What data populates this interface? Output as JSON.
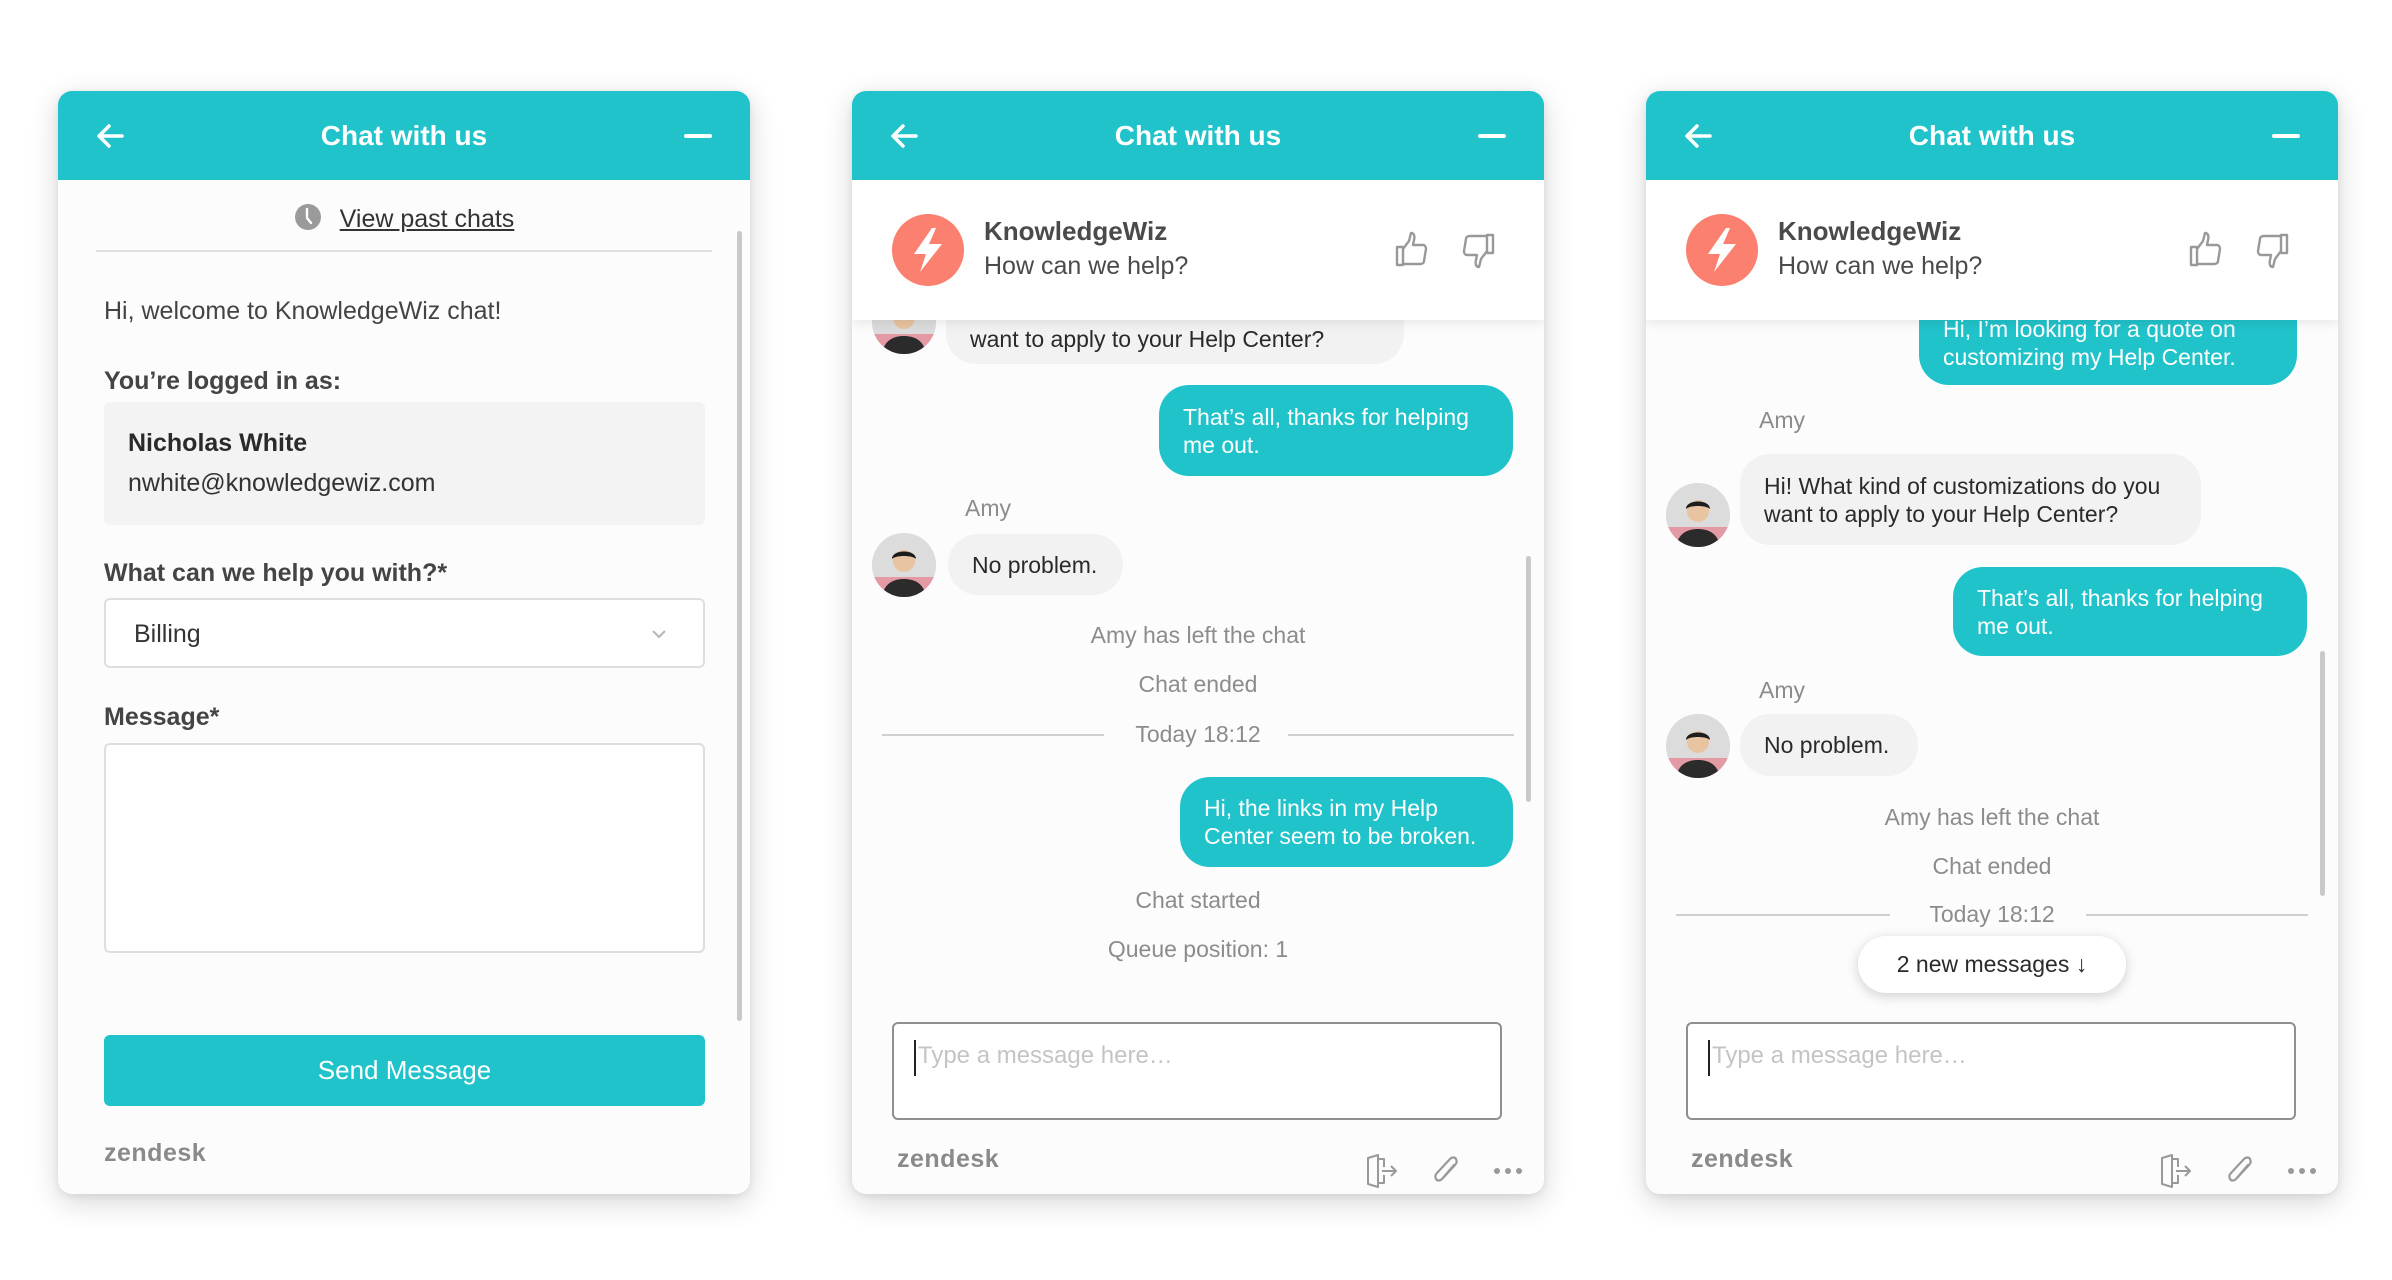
{
  "colors": {
    "accent": "#21c3cb",
    "brand_logo": "#fb806f"
  },
  "header": {
    "title": "Chat with us",
    "back_icon": "arrow-left-icon",
    "minimize_icon": "minus-icon"
  },
  "prechat": {
    "past_chats_link": "View past chats",
    "welcome": "Hi, welcome to KnowledgeWiz chat!",
    "logged_in_label": "You’re logged in as:",
    "user_name": "Nicholas White",
    "user_email": "nwhite@knowledgewiz.com",
    "department_label": "What can we help you with?*",
    "department_value": "Billing",
    "message_label": "Message*",
    "message_value": "",
    "send_button": "Send Message",
    "branding": "zendesk"
  },
  "agent_card": {
    "name": "KnowledgeWiz",
    "subtitle": "How can we help?",
    "logo_icon": "lightning-bolt-icon",
    "rate_good_icon": "thumbs-up-icon",
    "rate_bad_icon": "thumbs-down-icon"
  },
  "chat1": {
    "messages": [
      {
        "from": "agent",
        "text": "want to apply to your Help Center?"
      },
      {
        "from": "user",
        "text": "That’s all, thanks for helping me out."
      },
      {
        "from": "agent",
        "sender": "Amy",
        "text": "No problem."
      }
    ],
    "events": [
      "Amy has left the chat",
      "Chat ended"
    ],
    "date_separator": "Today 18:12",
    "messages2": [
      {
        "from": "user",
        "text": "Hi, the links in my Help Center seem to be broken."
      }
    ],
    "events2": [
      "Chat started",
      "Queue position: 1"
    ]
  },
  "chat2": {
    "messages": [
      {
        "from": "user",
        "text": "Hi, I’m looking for a quote on customizing my Help Center."
      },
      {
        "from": "agent",
        "sender": "Amy",
        "text": "Hi! What kind of customizations do you want to apply to your Help Center?"
      },
      {
        "from": "user",
        "text": "That’s all, thanks for helping me out."
      },
      {
        "from": "agent",
        "sender": "Amy",
        "text": "No problem."
      }
    ],
    "events": [
      "Amy has left the chat",
      "Chat ended"
    ],
    "date_separator": "Today 18:12",
    "new_messages_pill": "2 new messages ↓"
  },
  "composer": {
    "placeholder": "Type a message here…",
    "branding": "zendesk",
    "end_chat_icon": "exit-icon",
    "attach_icon": "paperclip-icon",
    "more_icon": "more-dots-icon"
  }
}
